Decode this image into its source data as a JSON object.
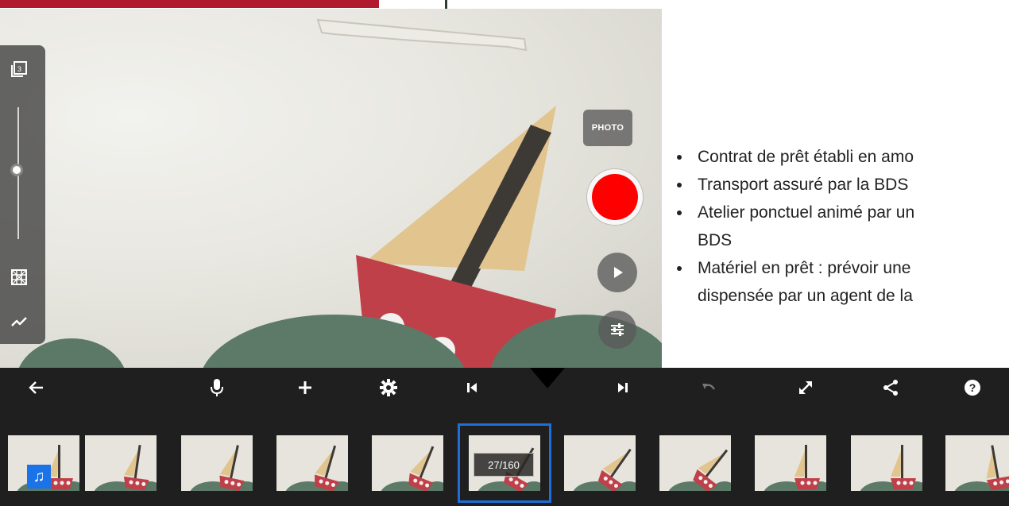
{
  "camera": {
    "photo_label": "PHOTO"
  },
  "left_panel": {
    "icons": [
      "burst-icon",
      "grid-overlay-icon",
      "chart-icon"
    ],
    "zoom_level": 0.45
  },
  "bullets": [
    "Contrat de prêt établi en amo",
    "Transport assuré par la BDS",
    "Atelier ponctuel animé par un",
    "Matériel en prêt : prévoir une"
  ],
  "bullet_continuations": {
    "item3": "BDS",
    "item4": "dispensée par un agent de la"
  },
  "toolbar": {
    "icons": [
      "back-arrow-icon",
      "microphone-icon",
      "plus-icon",
      "settings-gear-icon",
      "skip-to-start-icon",
      "skip-to-end-icon",
      "undo-icon",
      "fullscreen-icon",
      "share-icon",
      "help-icon"
    ]
  },
  "filmstrip": {
    "counter": "27/160",
    "selected_index": 5,
    "frame_count": 11,
    "music_glyph": "♫"
  },
  "colors": {
    "accent_red": "#b11a2d",
    "record_red": "#ff0000",
    "selection_blue": "#1e6fd9",
    "toolbar_bg": "#1f1f1f"
  }
}
